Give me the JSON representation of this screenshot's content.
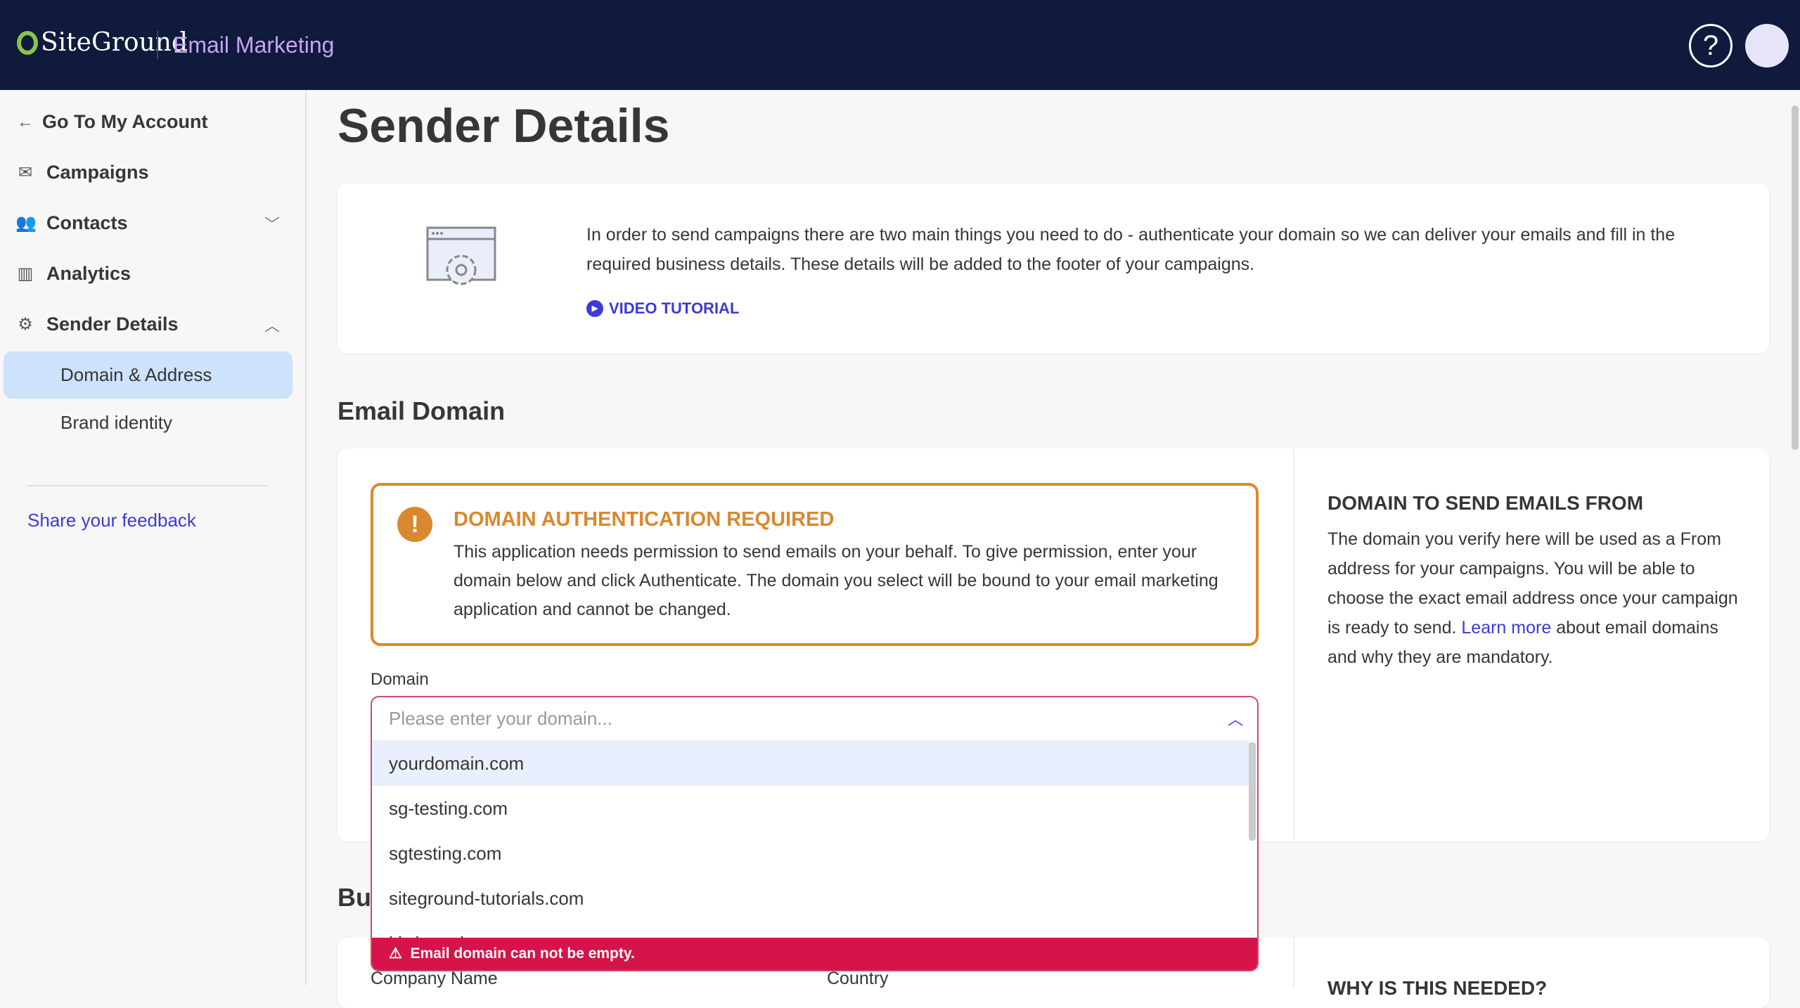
{
  "header": {
    "logo": "SiteGround",
    "app_name": "Email Marketing",
    "help_icon": "question-icon"
  },
  "sidebar": {
    "back": "Go To My Account",
    "items": [
      {
        "label": "Campaigns",
        "icon": "mail-icon"
      },
      {
        "label": "Contacts",
        "icon": "users-icon"
      },
      {
        "label": "Analytics",
        "icon": "chart-icon"
      },
      {
        "label": "Sender Details",
        "icon": "gear-icon"
      }
    ],
    "sub_items": [
      {
        "label": "Domain & Address",
        "active": true
      },
      {
        "label": "Brand identity",
        "active": false
      }
    ],
    "feedback": "Share your feedback"
  },
  "page": {
    "title": "Sender Details"
  },
  "intro": {
    "text": "In order to send campaigns there are two main things you need to do - authenticate your domain so we can deliver your emails and fill in the required business details. These details will be added to the footer of your campaigns.",
    "video": "VIDEO TUTORIAL"
  },
  "email_domain": {
    "heading": "Email Domain",
    "warning_title": "DOMAIN AUTHENTICATION REQUIRED",
    "warning_text": "This application needs permission to send emails on your behalf. To give permission, enter your domain below and click Authenticate. The domain you select will be bound to your email marketing application and cannot be changed.",
    "domain_label": "Domain",
    "placeholder": "Please enter your domain...",
    "options": [
      "yourdomain.com",
      "sg-testing.com",
      "sgtesting.com",
      "siteground-tutorials.com",
      "kiwitravel.com"
    ],
    "error": "Email domain can not be empty.",
    "right_title": "DOMAIN TO SEND EMAILS FROM",
    "right_text_before": "The domain you verify here will be used as a From address for your campaigns. You will be able to choose the exact email address once your campaign is ready to send. ",
    "right_link": "Learn more",
    "right_text_after": " about email domains and why they are mandatory."
  },
  "business": {
    "heading": "Business Details",
    "company_label": "Company Name",
    "country_label": "Country",
    "why_title": "WHY IS THIS NEEDED?"
  },
  "colors": {
    "header": "#0f1a3d",
    "accent": "#3b3bd6",
    "warning": "#d9882e",
    "error": "#d4144a"
  }
}
